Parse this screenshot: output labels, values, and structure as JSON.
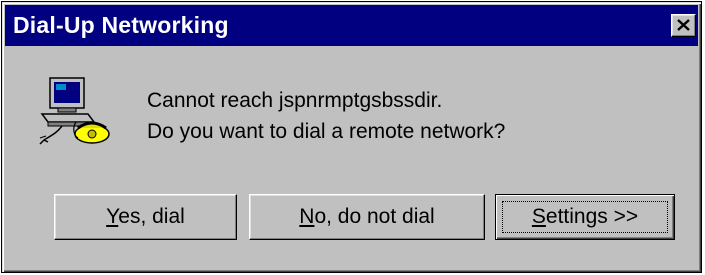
{
  "window": {
    "title": "Dial-Up Networking",
    "close_glyph": "×"
  },
  "message": {
    "icon": "computer-phone-icon",
    "line1": "Cannot reach jspnrmptgsbssdir.",
    "line2": "Do you want to dial a remote network?"
  },
  "buttons": {
    "yes": {
      "mnemonic": "Y",
      "rest": "es, dial"
    },
    "no": {
      "mnemonic": "N",
      "rest": "o, do not dial"
    },
    "settings": {
      "mnemonic": "S",
      "rest": "ettings >>"
    }
  },
  "colors": {
    "titlebar": "#000080",
    "face": "#c0c0c0"
  }
}
